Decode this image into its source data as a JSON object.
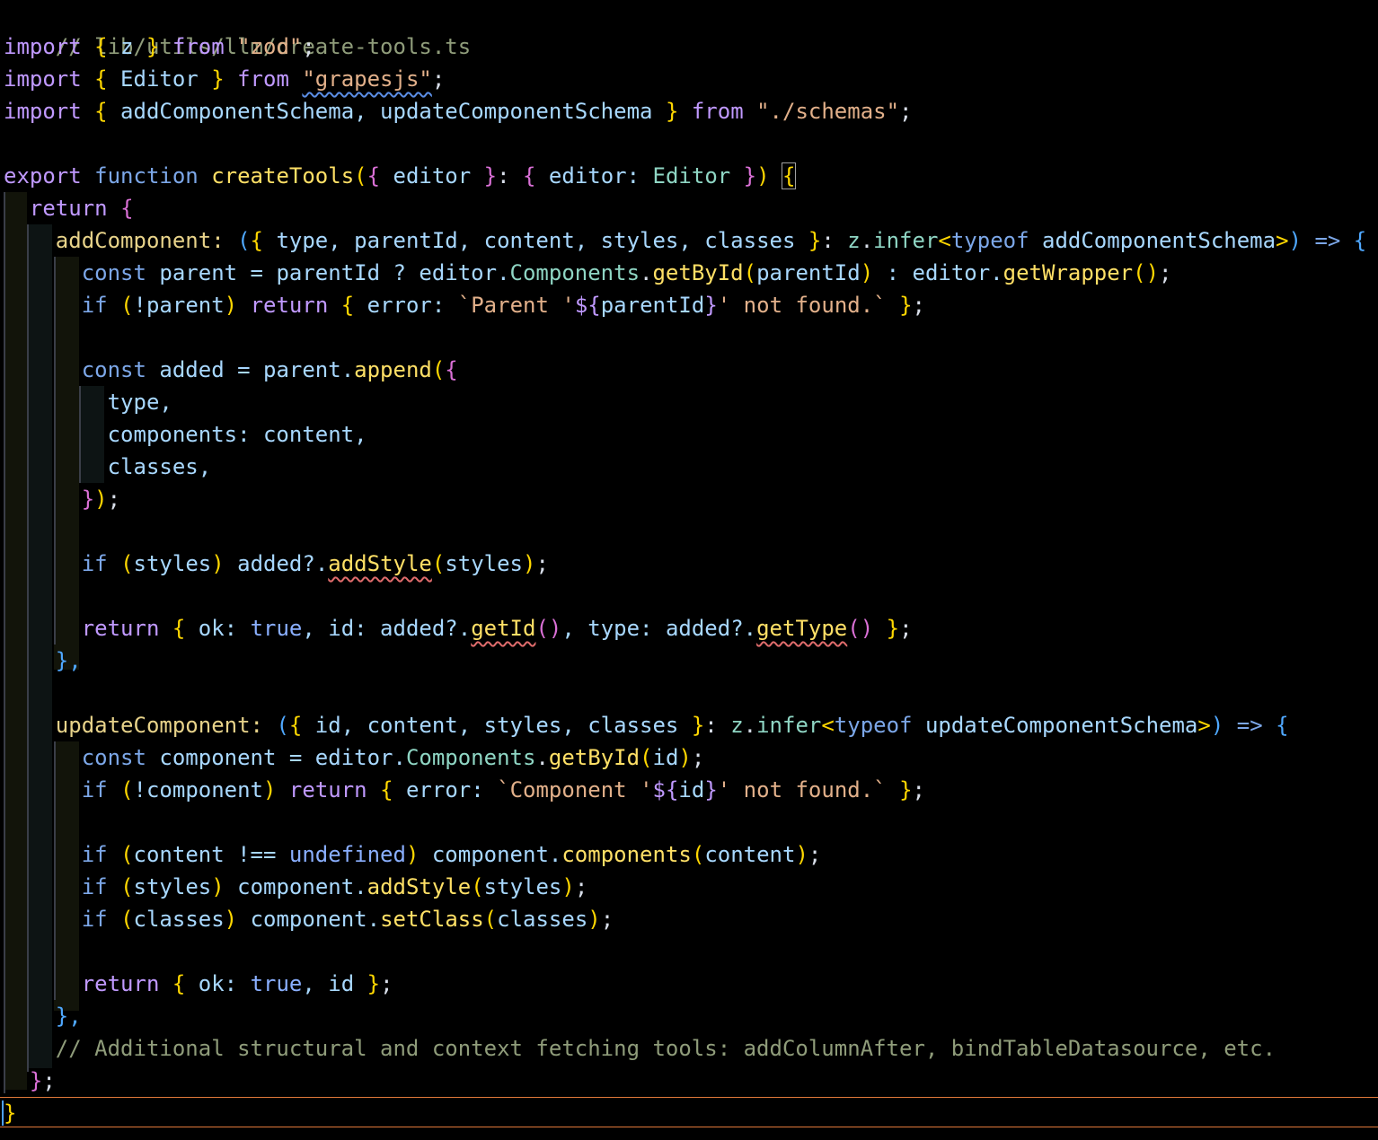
{
  "file": {
    "path_comment": "// lib/utils/llm/create-tools.ts"
  },
  "lines": {
    "l2": [
      "import",
      " ",
      "{",
      " z ",
      "}",
      " ",
      "from",
      " ",
      "\"zod\"",
      ";"
    ],
    "l3": [
      "import",
      " ",
      "{",
      " Editor ",
      "}",
      " ",
      "from",
      " ",
      "\"grapesjs\"",
      ";"
    ],
    "l4": [
      "import",
      " ",
      "{",
      " addComponentSchema, updateComponentSchema ",
      "}",
      " ",
      "from",
      " ",
      "\"./schemas\"",
      ";"
    ],
    "l6": [
      "export",
      " ",
      "function",
      " ",
      "createTools",
      "(",
      "{",
      " editor ",
      "}",
      ": ",
      "{",
      " editor: ",
      "Editor",
      " ",
      "}",
      ")",
      " ",
      "{"
    ],
    "l7": [
      "  ",
      "return",
      " ",
      "{"
    ],
    "l8": [
      "    addComponent: ",
      "(",
      "{",
      " type, parentId, content, styles, classes ",
      "}",
      ": ",
      "z",
      ".",
      "infer",
      "<",
      "typeof",
      " addComponentSchema",
      ">",
      ")",
      " => ",
      "{"
    ],
    "l9": [
      "      ",
      "const",
      " parent = parentId ? editor.",
      "Components",
      ".",
      "getById",
      "(",
      "parentId",
      ")",
      " : editor.",
      "getWrapper",
      "()",
      ";"
    ],
    "l10": [
      "      ",
      "if",
      " ",
      "(",
      "!parent",
      ")",
      " ",
      "return",
      " ",
      "{",
      " error: ",
      "`Parent '",
      "${",
      "parentId",
      "}",
      "' not found.`",
      " ",
      "}",
      ";"
    ],
    "l12": [
      "      ",
      "const",
      " added = parent.",
      "append",
      "(",
      "{"
    ],
    "l13": [
      "        type,"
    ],
    "l14": [
      "        components: content,"
    ],
    "l15": [
      "        classes,"
    ],
    "l16": [
      "      ",
      "}",
      ")",
      ";"
    ],
    "l18": [
      "      ",
      "if",
      " ",
      "(",
      "styles",
      ")",
      " added?.",
      "addStyle",
      "(",
      "styles",
      ")",
      ";"
    ],
    "l20": [
      "      ",
      "return",
      " ",
      "{",
      " ok: ",
      "true",
      ", id: added?.",
      "getId",
      "()",
      ", type: added?.",
      "getType",
      "()",
      " ",
      "}",
      ";"
    ],
    "l21": [
      "    },"
    ],
    "l23": [
      "    updateComponent: ",
      "(",
      "{",
      " id, content, styles, classes ",
      "}",
      ": ",
      "z",
      ".",
      "infer",
      "<",
      "typeof",
      " updateComponentSchema",
      ">",
      ")",
      " => ",
      "{"
    ],
    "l24": [
      "      ",
      "const",
      " component = editor.",
      "Components",
      ".",
      "getById",
      "(",
      "id",
      ")",
      ";"
    ],
    "l25": [
      "      ",
      "if",
      " ",
      "(",
      "!component",
      ")",
      " ",
      "return",
      " ",
      "{",
      " error: ",
      "`Component '",
      "${",
      "id",
      "}",
      "' not found.`",
      " ",
      "}",
      ";"
    ],
    "l27": [
      "      ",
      "if",
      " ",
      "(",
      "content !== ",
      "undefined",
      ")",
      " component.",
      "components",
      "(",
      "content",
      ")",
      ";"
    ],
    "l28": [
      "      ",
      "if",
      " ",
      "(",
      "styles",
      ")",
      " component.",
      "addStyle",
      "(",
      "styles",
      ")",
      ";"
    ],
    "l29": [
      "      ",
      "if",
      " ",
      "(",
      "classes",
      ")",
      " component.",
      "setClass",
      "(",
      "classes",
      ")",
      ";"
    ],
    "l31": [
      "      ",
      "return",
      " ",
      "{",
      " ok: ",
      "true",
      ", id ",
      "}",
      ";"
    ],
    "l32": [
      "    },"
    ],
    "l33": [
      "    ",
      "// Additional structural and context fetching tools: addColumnAfter, bindTableDatasource, etc."
    ],
    "l34": [
      "  ",
      "}",
      ";"
    ],
    "l35": [
      "}"
    ]
  }
}
